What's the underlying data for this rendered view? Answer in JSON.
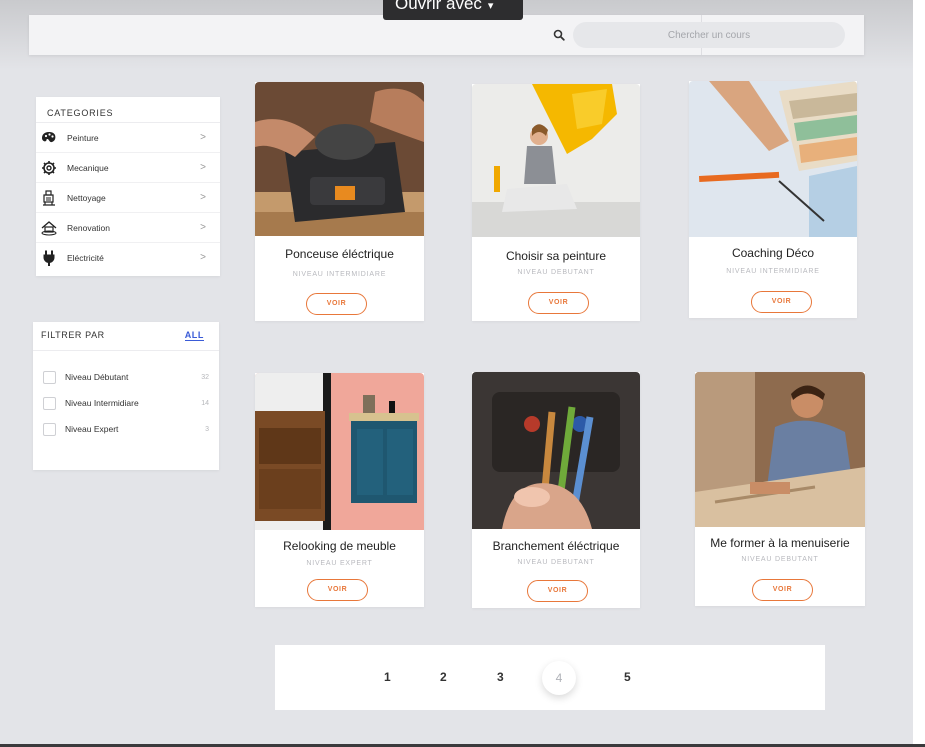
{
  "overlay": {
    "open_with_label": "Ouvrir avec",
    "arrow": "▾"
  },
  "search": {
    "placeholder": "Chercher un cours",
    "icon": "search-icon"
  },
  "categories": {
    "title": "CATEGORIES",
    "items": [
      {
        "label": "Peinture",
        "icon": "paint-palette-icon"
      },
      {
        "label": "Mecanique",
        "icon": "gear-icon"
      },
      {
        "label": "Nettoyage",
        "icon": "cleaning-icon"
      },
      {
        "label": "Renovation",
        "icon": "renovation-icon"
      },
      {
        "label": "Eléctricité",
        "icon": "electric-plug-icon"
      }
    ],
    "chevron": ">"
  },
  "filter": {
    "title": "FILTRER PAR",
    "all_label": "ALL",
    "options": [
      {
        "label": "Niveau Débutant",
        "count": "32"
      },
      {
        "label": "Niveau Intermidiare",
        "count": "14"
      },
      {
        "label": "Niveau Expert",
        "count": "3"
      }
    ]
  },
  "courses": [
    {
      "title": "Ponceuse éléctrique",
      "level": "NIVEAU INTERMIDIARE",
      "button": "VOIR"
    },
    {
      "title": "Choisir sa peinture",
      "level": "NIVEAU DEBUTANT",
      "button": "VOIR"
    },
    {
      "title": "Coaching Déco",
      "level": "NIVEAU INTERMIDIARE",
      "button": "VOIR"
    },
    {
      "title": "Relooking de meuble",
      "level": "NIVEAU EXPERT",
      "button": "VOIR"
    },
    {
      "title": "Branchement éléctrique",
      "level": "NIVEAU DEBUTANT",
      "button": "VOIR"
    },
    {
      "title": "Me former à la menuiserie",
      "level": "NIVEAU DEBUTANT",
      "button": "VOIR"
    }
  ],
  "pagination": {
    "pages": [
      "1",
      "2",
      "3",
      "4",
      "5"
    ],
    "current": "4"
  },
  "colors": {
    "accent": "#e8773a",
    "link": "#3a5bd7",
    "background": "#e3e4e8"
  }
}
